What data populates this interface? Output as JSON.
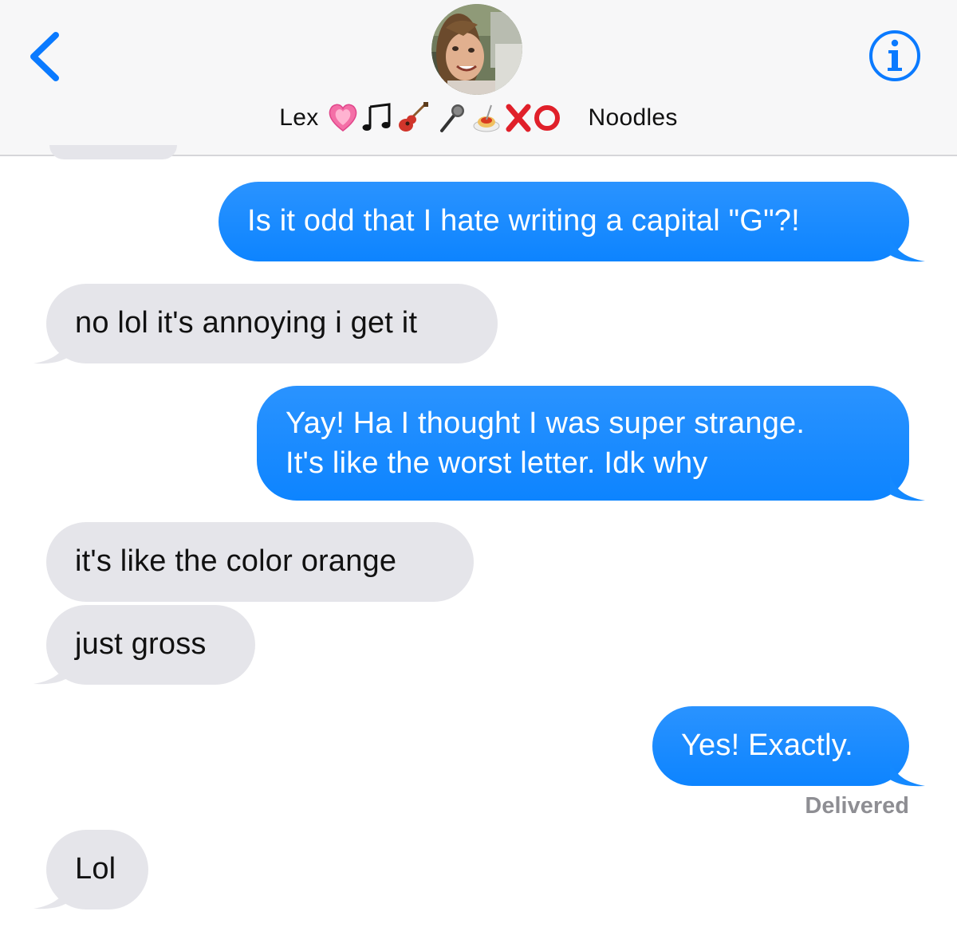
{
  "header": {
    "contact_name_first": "Lex",
    "contact_name_last": "Noodles",
    "emoji_names": [
      "growing-heart-icon",
      "music-notes-icon",
      "guitar-icon",
      "microphone-icon",
      "spaghetti-icon",
      "cross-mark-icon",
      "hollow-circle-icon"
    ],
    "accent_color": "#0a7aff"
  },
  "messages": [
    {
      "id": "m1",
      "direction": "outgoing",
      "text": "Is it odd that I hate writing a capital \"G\"?!"
    },
    {
      "id": "m2",
      "direction": "incoming",
      "text": "no lol it's annoying i get it"
    },
    {
      "id": "m3",
      "direction": "outgoing",
      "lines": [
        "Yay! Ha I thought I was super strange.",
        "It's like the worst letter. Idk why"
      ]
    },
    {
      "id": "m4",
      "direction": "incoming",
      "text": "it's like the color orange"
    },
    {
      "id": "m5",
      "direction": "incoming",
      "text": "just gross"
    },
    {
      "id": "m6",
      "direction": "outgoing",
      "text": "Yes! Exactly."
    },
    {
      "id": "m7",
      "direction": "incoming",
      "text": "Lol"
    }
  ],
  "status": {
    "delivered_label": "Delivered"
  },
  "colors": {
    "outgoing_bubble": "#1a8cff",
    "incoming_bubble": "#e5e5ea",
    "status_text": "#8e8e93"
  }
}
